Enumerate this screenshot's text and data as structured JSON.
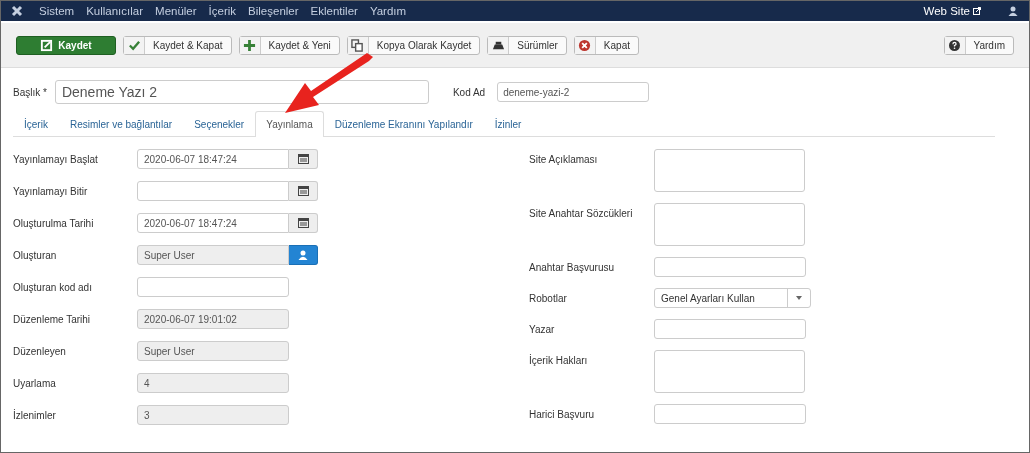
{
  "top_menu": {
    "items": [
      "Sistem",
      "Kullanıcılar",
      "Menüler",
      "İçerik",
      "Bileşenler",
      "Eklentiler",
      "Yardım"
    ],
    "site_link": "Web Site"
  },
  "toolbar": {
    "buttons": [
      {
        "label": "Kaydet",
        "kind": "primary"
      },
      {
        "label": "Kaydet & Kapat",
        "kind": "normal"
      },
      {
        "label": "Kaydet & Yeni",
        "kind": "normal"
      },
      {
        "label": "Kopya Olarak Kaydet",
        "kind": "normal"
      },
      {
        "label": "Sürümler",
        "kind": "normal"
      },
      {
        "label": "Kapat",
        "kind": "normal"
      }
    ],
    "help_button": "Yardım"
  },
  "title_field": {
    "label": "Başlık *",
    "value": "Deneme Yazı 2"
  },
  "alias_field": {
    "label": "Kod Ad",
    "value": "deneme-yazi-2"
  },
  "tabs": [
    {
      "label": "İçerik",
      "selected": false
    },
    {
      "label": "Resimler ve bağlantılar",
      "selected": false
    },
    {
      "label": "Seçenekler",
      "selected": false
    },
    {
      "label": "Yayınlama",
      "selected": true
    },
    {
      "label": "Düzenleme Ekranını Yapılandır",
      "selected": false
    },
    {
      "label": "İzinler",
      "selected": false
    }
  ],
  "left_fields": [
    {
      "label": "Yayınlamayı Başlat",
      "kind": "date",
      "value": "2020-06-07 18:47:24",
      "disabled": false
    },
    {
      "label": "Yayınlamayı Bitir",
      "kind": "date",
      "disabled": false
    },
    {
      "label": "Oluşturulma Tarihi",
      "kind": "date",
      "value": "2020-06-07 18:47:24",
      "disabled": false
    },
    {
      "label": "Oluşturan",
      "kind": "user",
      "value": "Super User",
      "disabled": true
    },
    {
      "label": "Oluşturan kod adı",
      "kind": "text",
      "disabled": false
    },
    {
      "label": "Düzenleme Tarihi",
      "kind": "text",
      "value": "2020-06-07 19:01:02",
      "disabled": true
    },
    {
      "label": "Düzenleyen",
      "kind": "text",
      "value": "Super User",
      "disabled": true
    },
    {
      "label": "Uyarlama",
      "kind": "text",
      "value": "4",
      "disabled": true
    },
    {
      "label": "İzlenimler",
      "kind": "text",
      "value": "3",
      "disabled": true
    }
  ],
  "right_fields": [
    {
      "label": "Site Açıklaması",
      "kind": "textarea"
    },
    {
      "label": "Site Anahtar Sözcükleri",
      "kind": "textarea"
    },
    {
      "label": "Anahtar Başvurusu",
      "kind": "text"
    },
    {
      "label": "Robotlar",
      "kind": "select",
      "value": "Genel Ayarları Kullan"
    },
    {
      "label": "Yazar",
      "kind": "text"
    },
    {
      "label": "İçerik Hakları",
      "kind": "textarea"
    },
    {
      "label": "Harici Başvuru",
      "kind": "text"
    }
  ]
}
